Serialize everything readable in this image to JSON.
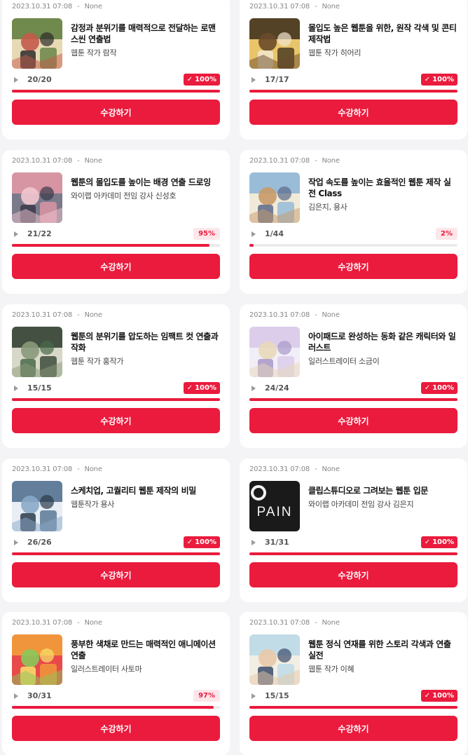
{
  "theme": {
    "accent": "#ea1b3d",
    "badge_partial_bg": "#fde6ea"
  },
  "icons": {
    "play": "play-icon",
    "check": "check-icon"
  },
  "courses": [
    {
      "date": "2023.10.31 07:08",
      "status": "None",
      "title": "감정과 분위기를 매력적으로 전달하는 로맨스씬 연출법",
      "author": "웹툰 작가 람작",
      "progress": "20/20",
      "percent": 100,
      "percent_label": "100%",
      "complete": true,
      "button": "수강하기",
      "thumb_colors": [
        "#5a7a3a",
        "#e8d9b5",
        "#2b2b2b",
        "#c45a4a"
      ]
    },
    {
      "date": "2023.10.31 07:08",
      "status": "None",
      "title": "몰입도 높은 웹툰을 위한, 원작 각색 및 콘티 제작법",
      "author": "웹툰 작가 히어리",
      "progress": "17/17",
      "percent": 100,
      "percent_label": "100%",
      "complete": true,
      "button": "수강하기",
      "thumb_colors": [
        "#3a2a1a",
        "#e8c56a",
        "#f2e6cf",
        "#6a4a2a"
      ]
    },
    {
      "date": "2023.10.31 07:08",
      "status": "None",
      "title": "웹툰의 몰입도를 높이는 배경 연출 드로잉",
      "author": "와이랩 아카데미 전임 강사 신성호",
      "progress": "21/22",
      "percent": 95,
      "percent_label": "95%",
      "complete": false,
      "button": "수강하기",
      "thumb_colors": [
        "#e89aa8",
        "#7a7a8a",
        "#3a3a4a",
        "#f2c6cf"
      ]
    },
    {
      "date": "2023.10.31 07:08",
      "status": "None",
      "title": "작업 속도를 높이는 효율적인 웹툰 제작 실전 Class",
      "author": "김은지, 용사",
      "progress": "1/44",
      "percent": 2,
      "percent_label": "2%",
      "complete": false,
      "button": "수강하기",
      "thumb_colors": [
        "#8ab4d8",
        "#f2ead8",
        "#5a6a8a",
        "#c89a6a"
      ]
    },
    {
      "date": "2023.10.31 07:08",
      "status": "None",
      "title": "웹툰의 분위기를 압도하는 임팩트 컷 연출과 작화",
      "author": "웹툰 작가 홍작가",
      "progress": "15/15",
      "percent": 100,
      "percent_label": "100%",
      "complete": true,
      "button": "수강하기",
      "thumb_colors": [
        "#2a3a2a",
        "#d8d8c8",
        "#4a6a4a",
        "#8a9a7a"
      ]
    },
    {
      "date": "2023.10.31 07:08",
      "status": "None",
      "title": "아이패드로 완성하는 동화 같은 캐릭터와 일러스트",
      "author": "일러스트레이터 소금이",
      "progress": "24/24",
      "percent": 100,
      "percent_label": "100%",
      "complete": true,
      "button": "수강하기",
      "thumb_colors": [
        "#d8c8e8",
        "#f2eef8",
        "#a898c8",
        "#e8d8b8"
      ]
    },
    {
      "date": "2023.10.31 07:08",
      "status": "None",
      "title": "스케치업, 고퀄리티 웹툰 제작의 비밀",
      "author": "웹툰작가 용사",
      "progress": "26/26",
      "percent": 100,
      "percent_label": "100%",
      "complete": true,
      "button": "수강하기",
      "thumb_colors": [
        "#4a6a8a",
        "#e8eef4",
        "#2a3a4a",
        "#8aa8c8"
      ]
    },
    {
      "date": "2023.10.31 07:08",
      "status": "None",
      "title": "클립스튜디오로 그려보는 웹툰 입문",
      "author": "와이랩 아카데미 전임 강사 김은지",
      "progress": "31/31",
      "percent": 100,
      "percent_label": "100%",
      "complete": true,
      "button": "수강하기",
      "thumb_colors": [
        "#1a1a1a",
        "#2a2a2a",
        "#f2f2f2",
        "#3a3a3a"
      ],
      "thumb_text": "PAIN"
    },
    {
      "date": "2023.10.31 07:08",
      "status": "None",
      "title": "풍부한 색채로 만드는 매력적인 애니메이션 연출",
      "author": "일러스트레이터 사토마",
      "progress": "30/31",
      "percent": 97,
      "percent_label": "97%",
      "complete": false,
      "button": "수강하기",
      "thumb_colors": [
        "#f2a23a",
        "#e84a4a",
        "#f8e26a",
        "#8ac85a"
      ]
    },
    {
      "date": "2023.10.31 07:08",
      "status": "None",
      "title": "웹툰 정식 연재를 위한 스토리 각색과 연출 실전",
      "author": "웹툰 작가 이혜",
      "progress": "15/15",
      "percent": 100,
      "percent_label": "100%",
      "complete": true,
      "button": "수강하기",
      "thumb_colors": [
        "#b8d8e8",
        "#f2eee4",
        "#3a4a6a",
        "#e8c8a8"
      ]
    }
  ]
}
